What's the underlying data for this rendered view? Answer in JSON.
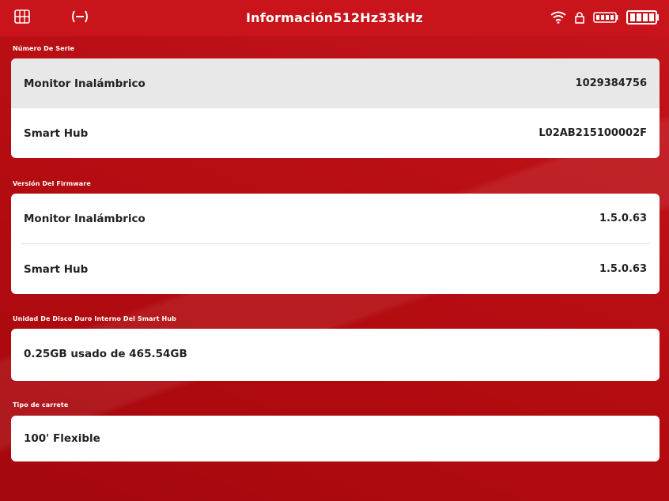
{
  "topbar": {
    "title": "Información512Hz33kHz",
    "icons": [
      "grid-icon",
      "signal-link-icon",
      "wifi-icon",
      "lock-icon",
      "remote-battery-icon",
      "battery-icon"
    ]
  },
  "sections": {
    "serial": {
      "label": "Número De Serie",
      "rows": [
        {
          "label": "Monitor Inalámbrico",
          "value": "1029384756"
        },
        {
          "label": "Smart Hub",
          "value": "L02AB215100002F"
        }
      ]
    },
    "firmware": {
      "label": "Versión Del Firmware",
      "rows": [
        {
          "label": "Monitor Inalámbrico",
          "value": "1.5.0.63"
        },
        {
          "label": "Smart Hub",
          "value": "1.5.0.63"
        }
      ]
    },
    "disk": {
      "label": "Unidad De Disco Duro Interno Del Smart Hub",
      "rows": [
        {
          "label": "0.25GB usado de 465.54GB"
        }
      ]
    },
    "reel": {
      "label": "Tipo de carrete",
      "rows": [
        {
          "label": "100' Flexible"
        }
      ]
    }
  },
  "colors": {
    "accent": "#c8141a",
    "background": "#b80d12",
    "card": "#ffffff"
  }
}
